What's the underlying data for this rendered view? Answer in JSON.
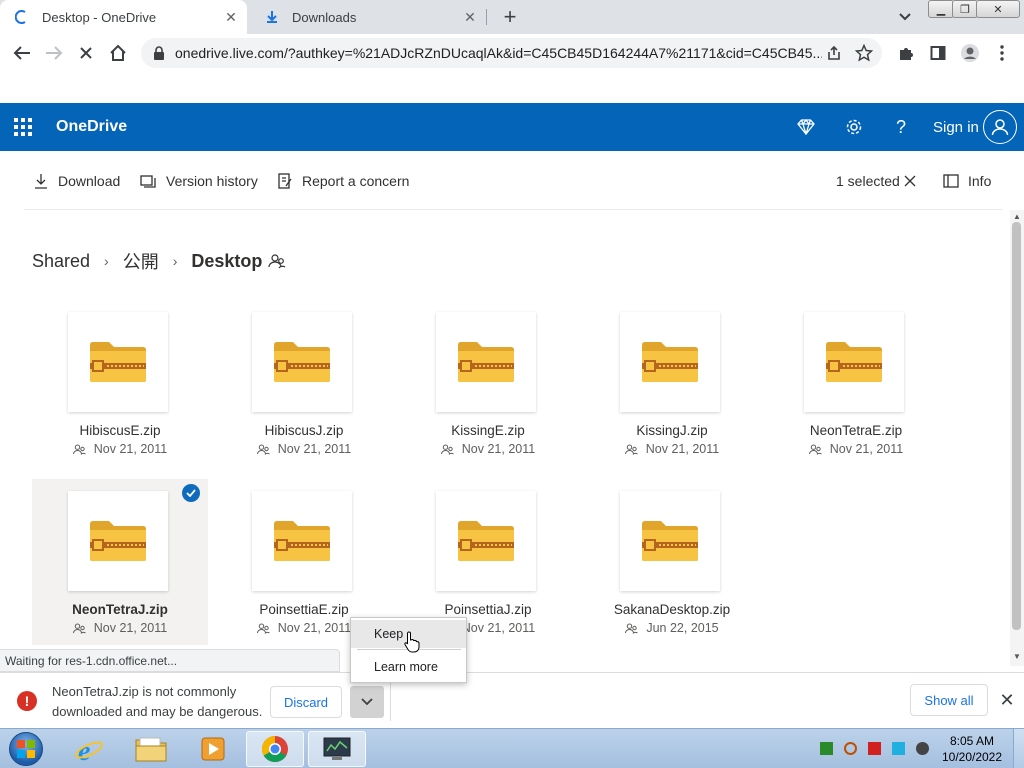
{
  "browser": {
    "tabs": [
      {
        "title": "Desktop - OneDrive",
        "active": true
      },
      {
        "title": "Downloads",
        "active": false
      }
    ],
    "url": "onedrive.live.com/?authkey=%21ADJcRZnDUcaqlAk&id=C45CB45D164244A7%21171&cid=C45CB45...",
    "status_text": "Waiting for res-1.cdn.office.net..."
  },
  "header": {
    "brand": "OneDrive",
    "sign_in": "Sign in"
  },
  "commands": {
    "download": "Download",
    "version_history": "Version history",
    "report": "Report a concern",
    "selected": "1 selected",
    "info": "Info"
  },
  "breadcrumb": {
    "items": [
      "Shared",
      "公開"
    ],
    "current": "Desktop"
  },
  "files": [
    {
      "name": "HibiscusE.zip",
      "date": "Nov 21, 2011"
    },
    {
      "name": "HibiscusJ.zip",
      "date": "Nov 21, 2011"
    },
    {
      "name": "KissingE.zip",
      "date": "Nov 21, 2011"
    },
    {
      "name": "KissingJ.zip",
      "date": "Nov 21, 2011"
    },
    {
      "name": "NeonTetraE.zip",
      "date": "Nov 21, 2011"
    },
    {
      "name": "NeonTetraJ.zip",
      "date": "Nov 21, 2011"
    },
    {
      "name": "PoinsettiaE.zip",
      "date": "Nov 21, 2011"
    },
    {
      "name": "PoinsettiaJ.zip",
      "date": "Nov 21, 2011"
    },
    {
      "name": "SakanaDesktop.zip",
      "date": "Jun 22, 2015"
    }
  ],
  "download_bar": {
    "message": "NeonTetraJ.zip is not commonly downloaded and may be dangerous.",
    "discard": "Discard",
    "show_all": "Show all"
  },
  "context_menu": {
    "keep": "Keep",
    "learn_more": "Learn more"
  },
  "taskbar": {
    "time": "8:05 AM",
    "date": "10/20/2022"
  },
  "colors": {
    "onedrive_blue": "#0364b8",
    "folder_yellow": "#f6c343",
    "zip_brown": "#b5651d",
    "warning_red": "#d93025",
    "link_blue": "#1a73e8"
  }
}
